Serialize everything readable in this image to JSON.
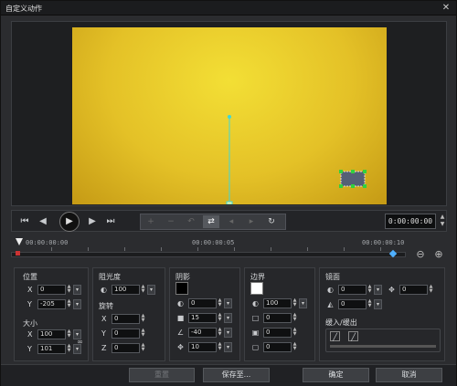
{
  "window": {
    "title": "自定义动作",
    "close_glyph": "✕"
  },
  "preview": {
    "canvas_color": "#e6c52a",
    "path_color": "#3fd7d7",
    "object_color": "#556075",
    "handle_color": "#31d13d"
  },
  "playback": {
    "go_start": "⏮",
    "prev_frame": "◀",
    "play": "▶",
    "next_frame": "▶",
    "go_end": "⏭",
    "timecode": "0:00:00:00"
  },
  "keyframe_tools": [
    {
      "name": "add-keyframe-icon",
      "glyph": "+",
      "enabled": false
    },
    {
      "name": "remove-keyframe-icon",
      "glyph": "−",
      "enabled": false
    },
    {
      "name": "reverse-keyframe-icon",
      "glyph": "↶",
      "enabled": false
    },
    {
      "name": "swap-keyframe-icon",
      "glyph": "⇄",
      "enabled": true
    },
    {
      "name": "prev-keyframe-icon",
      "glyph": "◂",
      "enabled": false
    },
    {
      "name": "next-keyframe-icon",
      "glyph": "▸",
      "enabled": false
    },
    {
      "name": "copy-keyframe-icon",
      "glyph": "↻",
      "enabled": true
    }
  ],
  "timeline": {
    "start": "00:00:00:00",
    "mid": "00:00:00:05",
    "end": "00:00:00:10",
    "zoom_out": "⊖",
    "zoom_in": "⊕"
  },
  "position": {
    "label": "位置",
    "x_label": "X",
    "x": "0",
    "y_label": "Y",
    "y": "-205"
  },
  "size": {
    "label": "大小",
    "x_label": "X",
    "x": "100",
    "y_label": "Y",
    "y": "101"
  },
  "opacity": {
    "label": "阻光度",
    "value": "100"
  },
  "rotation": {
    "label": "旋转",
    "x_label": "X",
    "x": "0",
    "y_label": "Y",
    "y": "0",
    "z_label": "Z",
    "z": "0"
  },
  "shadow": {
    "label": "阴影",
    "color": "#000000",
    "opacity": "0",
    "blur": "15",
    "angle": "-40",
    "distance": "10"
  },
  "border": {
    "label": "边界",
    "color": "#ffffff",
    "opacity": "100",
    "v1": "0",
    "v2": "0",
    "v3": "0"
  },
  "mirror": {
    "label": "镜面",
    "opacity": "0",
    "distance": "0",
    "offset": "0"
  },
  "fade": {
    "label": "缓入/缓出"
  },
  "footer": {
    "reset": "重置",
    "save_as": "保存至...",
    "ok": "确定",
    "cancel": "取消"
  }
}
